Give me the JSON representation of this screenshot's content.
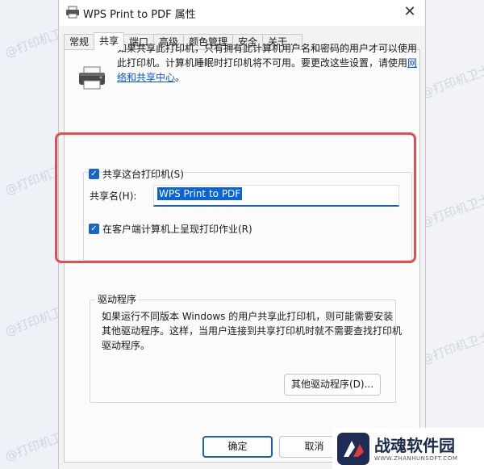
{
  "window": {
    "title": "WPS Print to PDF 属性",
    "close_glyph": "✕"
  },
  "tabs": [
    {
      "label": "常规"
    },
    {
      "label": "共享"
    },
    {
      "label": "端口"
    },
    {
      "label": "高级"
    },
    {
      "label": "颜色管理"
    },
    {
      "label": "安全"
    },
    {
      "label": "关于..."
    }
  ],
  "sharing": {
    "description": "如果共享此打印机，只有拥有此计算机用户名和密码的用户才可以使用此打印机。计算机睡眠时打印机将不可用。要更改这些设置，请使用",
    "link_text": "网络和共享中心",
    "link_suffix": "。",
    "share_checkbox_label": "共享这台打印机(S)",
    "share_checked": true,
    "share_name_label": "共享名(H):",
    "share_name_value": "WPS Print to PDF",
    "render_jobs_label": "在客户端计算机上呈现打印作业(R)",
    "render_jobs_checked": true
  },
  "drivers": {
    "legend": "驱动程序",
    "text": "如果运行不同版本 Windows 的用户共享此打印机，则可能需要安装其他驱动程序。这样，当用户连接到共享打印机时就不需要查找打印机驱动程序。",
    "additional_drivers_button": "其他驱动程序(D)..."
  },
  "footer": {
    "ok_button": "确定",
    "cancel_button": "取消"
  },
  "watermark_text": "@打印机卫士",
  "logo": {
    "name": "战魂软件园",
    "url": "WWW.ZHANHUNSOFT.COM"
  },
  "colors": {
    "accent": "#1765c8",
    "highlight_box": "#e05050",
    "link": "#0a56c8"
  }
}
